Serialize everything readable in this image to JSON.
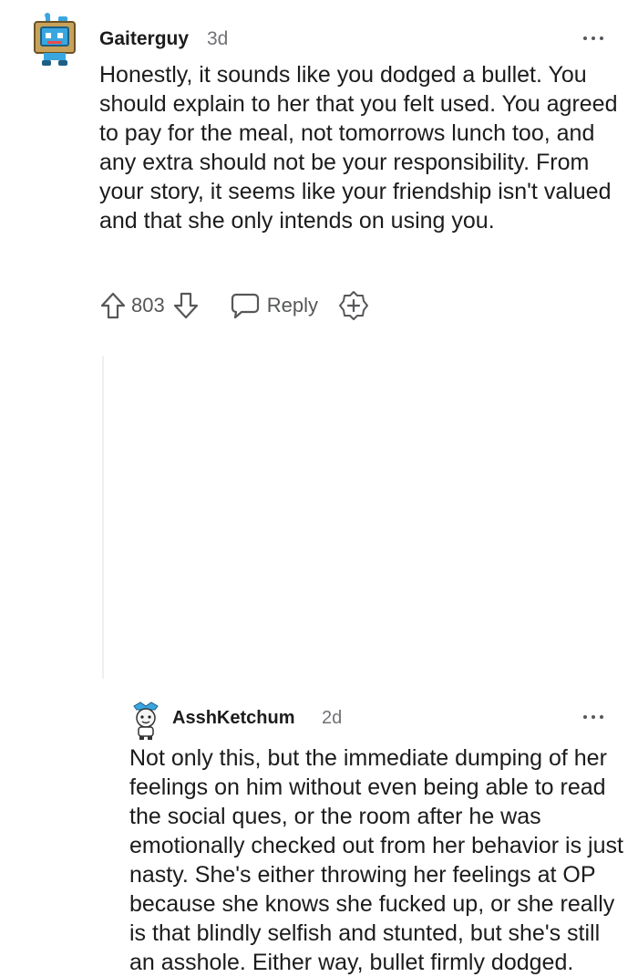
{
  "comments": [
    {
      "username": "Gaiterguy",
      "time": "3d",
      "avatar_icon": "robot-avatar-icon",
      "body": "Honestly, it sounds like you dodged a bullet. You should explain to her that you felt used. You agreed to pay for the meal, not tomorrows lunch too, and any extra should not be your responsibility. From your story, it seems like your friendship isn't valued and that she only intends on using you.",
      "votes": "803",
      "reply_label": "Reply"
    },
    {
      "username": "AsshKetchum",
      "time": "2d",
      "avatar_icon": "character-avatar-icon",
      "body": "Not only this, but the immediate dumping of her feelings on him without even being able to read the social ques, or the room after he was emotionally checked out from her behavior is just nasty. She's either throwing her feelings at OP because she knows she fucked up, or she really is that blindly selfish and stunted, but she's still an asshole. Either way, bullet firmly dodged."
    }
  ],
  "colors": {
    "text": "#1c1c1c",
    "muted": "#6f7175",
    "icon": "#555759",
    "avatar_blue": "#3aa6e0",
    "avatar_tan": "#c8a25a"
  }
}
